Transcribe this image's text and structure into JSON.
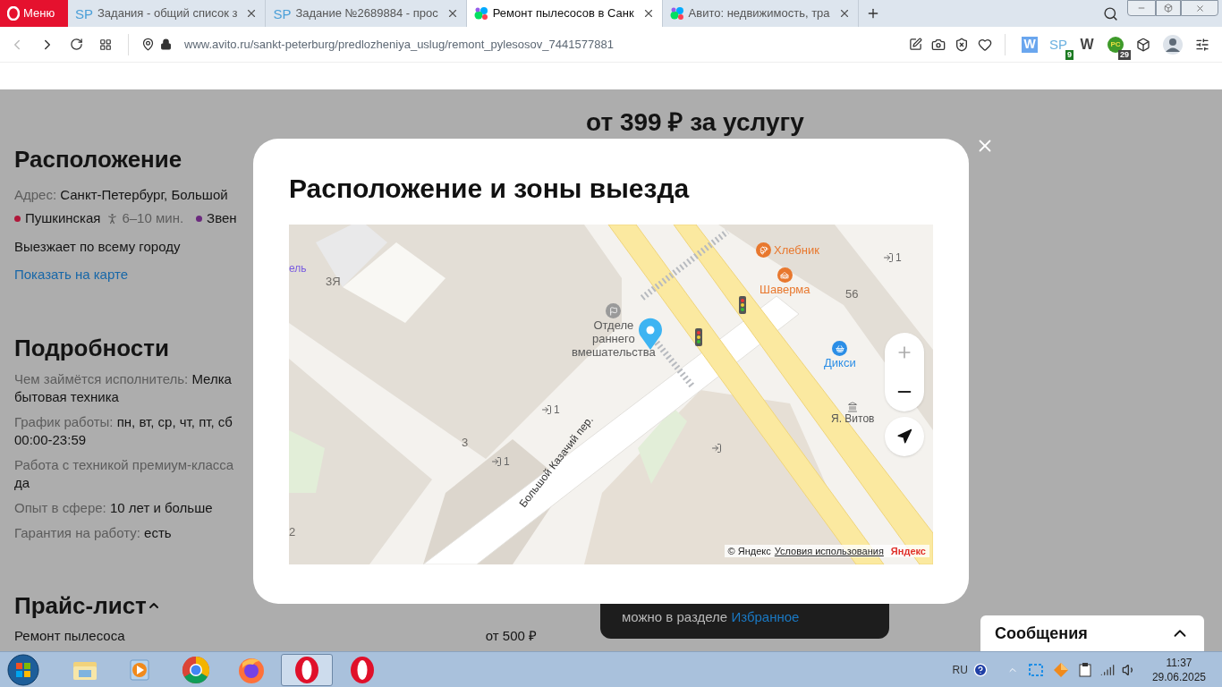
{
  "browser": {
    "menu_label": "Меню",
    "tabs": [
      {
        "title": "Задания - общий список з",
        "kind": "sp",
        "icon_text": "SP",
        "selected": false
      },
      {
        "title": "Задание №2689884 - прос",
        "kind": "sp",
        "icon_text": "SP",
        "selected": false
      },
      {
        "title": "Ремонт пылесосов в Санк",
        "kind": "avito",
        "selected": true
      },
      {
        "title": "Авито: недвижимость, тра",
        "kind": "avito",
        "selected": false
      }
    ],
    "url": "www.avito.ru/sankt-peterburg/predlozheniya_uslug/remont_pylesosov_7441577881",
    "extensions": [
      {
        "kind": "tile",
        "label": "W"
      },
      {
        "kind": "sp",
        "label": "SP",
        "badge": "9"
      },
      {
        "kind": "plain",
        "label": "W"
      },
      {
        "kind": "round",
        "label": "РС",
        "badge": "29"
      }
    ]
  },
  "page": {
    "price": "от 399 ₽ за услугу",
    "location": {
      "heading": "Расположение",
      "address_label": "Адрес:",
      "address": "Санкт-Петербург, Большой",
      "metro": [
        {
          "name": "Пушкинская",
          "color": "#b0173a",
          "walk": "6–10 мин."
        },
        {
          "name": "Звен",
          "color": "#6b2a7e"
        }
      ],
      "travel_note": "Выезжает по всему городу",
      "map_link": "Показать на карте"
    },
    "details": {
      "heading": "Подробности",
      "items": [
        {
          "label": "Чем займётся исполнитель:",
          "value": "Мелка",
          "value_next_line": "бытовая техника"
        },
        {
          "label": "График работы:",
          "value": "пн, вт, ср, чт, пт, сб",
          "value_next_line": "00:00-23:59"
        },
        {
          "label": "Работа с техникой премиум-класса",
          "value_next_line": "да"
        },
        {
          "label": "Опыт в сфере:",
          "value": "10 лет и больше"
        },
        {
          "label": "Гарантия на работу:",
          "value": "есть"
        }
      ]
    },
    "price_list": {
      "heading": "Прайс-лист",
      "expanded": true,
      "rows": [
        {
          "name": "Ремонт пылесоса",
          "price": "от 500 ₽"
        }
      ]
    },
    "toast": {
      "text": "можно в разделе",
      "link": "Избранное"
    },
    "messages": {
      "title": "Сообщения",
      "expanded": false
    }
  },
  "modal": {
    "title": "Расположение и зоны выезда",
    "map": {
      "labels": [
        {
          "kind": "place",
          "text": "ель",
          "color": "#7a5ce0"
        },
        {
          "kind": "house",
          "text": "3Я"
        },
        {
          "kind": "poi",
          "text": "Хлебник",
          "color": "#e8782e"
        },
        {
          "kind": "poi",
          "text": "Шаверма",
          "color": "#e8782e"
        },
        {
          "kind": "house",
          "text": "56"
        },
        {
          "kind": "entrance",
          "text": "1"
        },
        {
          "kind": "poi",
          "text": "Отделе\nраннего\nвмешательства",
          "color": "#5a5a5a"
        },
        {
          "kind": "poi",
          "text": "Дикси",
          "color": "#2b8ee6"
        },
        {
          "kind": "place",
          "text": "Я. Витов",
          "color": "#555555"
        },
        {
          "kind": "house",
          "text": "3"
        },
        {
          "kind": "entrance",
          "text": "1"
        },
        {
          "kind": "entrance",
          "text": "1"
        },
        {
          "kind": "house",
          "text": "2"
        },
        {
          "kind": "street",
          "text": "Большой Казачий пер."
        }
      ],
      "attribution": "© Яндекс",
      "terms_link": "Условия использования",
      "logo": "Яндекс"
    }
  },
  "taskbar": {
    "apps": [
      {
        "kind": "explorer",
        "selected": false
      },
      {
        "kind": "media",
        "selected": false
      },
      {
        "kind": "chrome",
        "selected": false
      },
      {
        "kind": "firefox",
        "selected": false
      },
      {
        "kind": "opera",
        "selected": true
      },
      {
        "kind": "opera",
        "selected": false
      }
    ],
    "language": "RU",
    "time": "11:37",
    "date": "29.06.2025"
  }
}
